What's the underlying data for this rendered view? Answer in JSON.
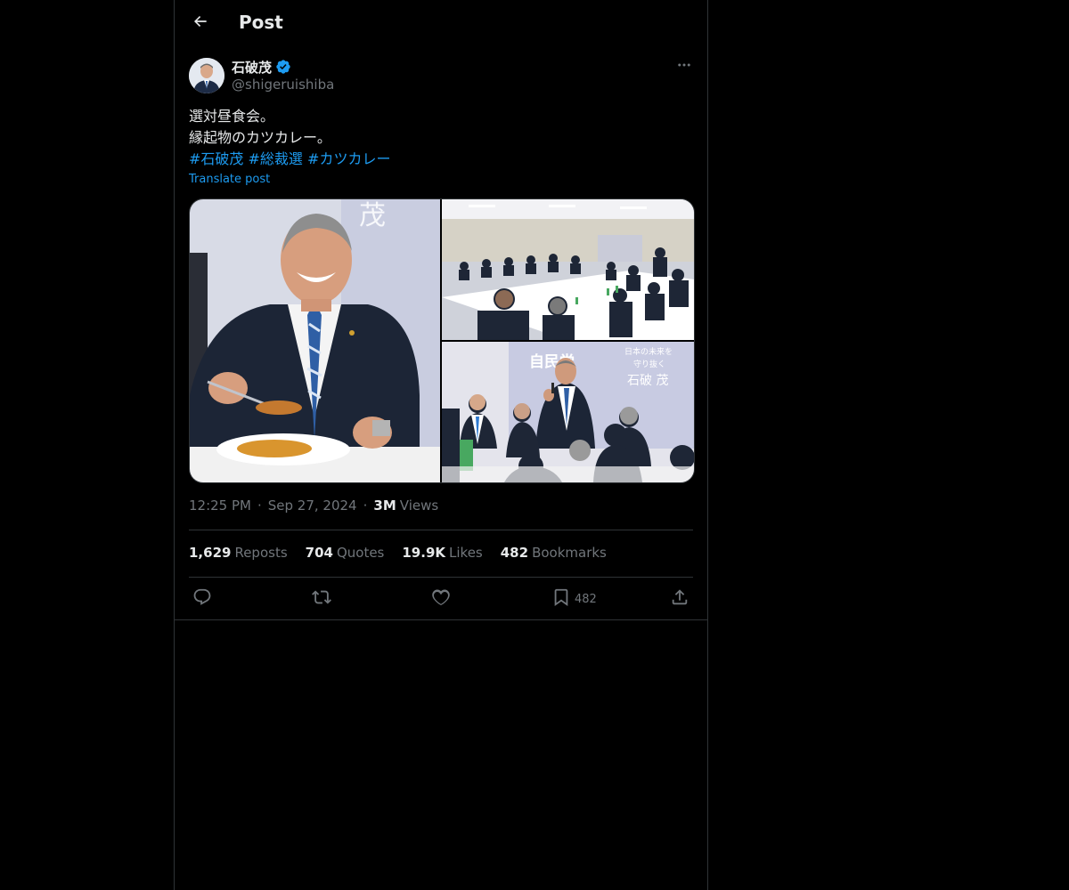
{
  "header": {
    "back_icon": "arrow-left-icon",
    "title": "Post"
  },
  "post": {
    "author": {
      "name": "石破茂",
      "handle": "@shigeruishiba",
      "verified_icon": "verified-badge-icon",
      "verified_color": "#1d9bf0"
    },
    "more_icon": "more-horizontal-icon",
    "text_lines": [
      "選対昼食会。",
      "縁起物のカツカレー。"
    ],
    "hashtags": [
      "#石破茂",
      "#総裁選",
      "#カツカレー"
    ],
    "translate_label": "Translate post",
    "media": [
      {
        "icon": "photo-smiling-man-eating-curry"
      },
      {
        "icon": "photo-meeting-room-table"
      },
      {
        "icon": "photo-man-speaking-microphone"
      }
    ],
    "time": "12:25 PM",
    "dot": "·",
    "date": "Sep 27, 2024",
    "views_count": "3M",
    "views_label": "Views",
    "stats": {
      "reposts_count": "1,629",
      "reposts_label": "Reposts",
      "quotes_count": "704",
      "quotes_label": "Quotes",
      "likes_count": "19.9K",
      "likes_label": "Likes",
      "bookmarks_count": "482",
      "bookmarks_label": "Bookmarks"
    },
    "actions": {
      "reply_icon": "reply-icon",
      "repost_icon": "repost-icon",
      "like_icon": "heart-icon",
      "bookmark_icon": "bookmark-icon",
      "bookmark_count": "482",
      "share_icon": "share-icon"
    }
  },
  "colors": {
    "background": "#000000",
    "text": "#e7e9ea",
    "secondary": "#71767b",
    "accent": "#1d9bf0",
    "border": "#2f3336"
  }
}
